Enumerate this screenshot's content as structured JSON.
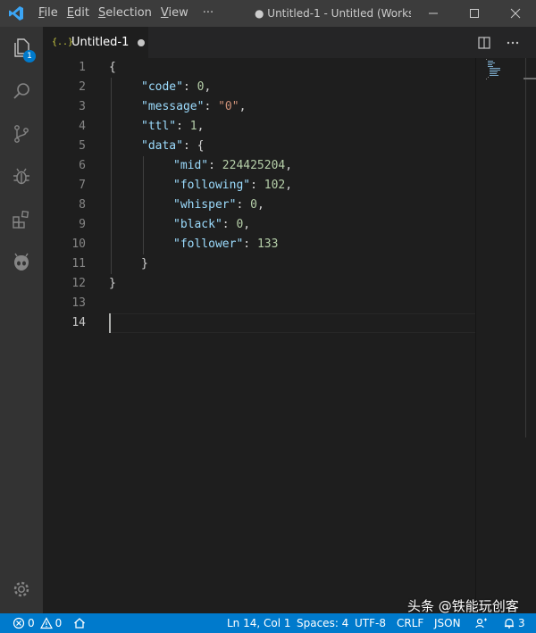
{
  "titlebar": {
    "menus": [
      {
        "mnemonic": "F",
        "rest": "ile"
      },
      {
        "mnemonic": "E",
        "rest": "dit"
      },
      {
        "mnemonic": "S",
        "rest": "election"
      },
      {
        "mnemonic": "V",
        "rest": "iew"
      }
    ],
    "more": "···",
    "title": "● Untitled-1 - Untitled (Worksp..."
  },
  "activitybar": {
    "explorer_badge": "1"
  },
  "tab": {
    "icon_glyph": "{..}",
    "label": "Untitled-1"
  },
  "editor": {
    "line_numbers": [
      "1",
      "2",
      "3",
      "4",
      "5",
      "6",
      "7",
      "8",
      "9",
      "10",
      "11",
      "12",
      "13",
      "14"
    ],
    "json": {
      "code_key": "\"code\"",
      "code_val": "0",
      "message_key": "\"message\"",
      "message_val": "\"0\"",
      "ttl_key": "\"ttl\"",
      "ttl_val": "1",
      "data_key": "\"data\"",
      "mid_key": "\"mid\"",
      "mid_val": "224425204",
      "following_key": "\"following\"",
      "following_val": "102",
      "whisper_key": "\"whisper\"",
      "whisper_val": "0",
      "black_key": "\"black\"",
      "black_val": "0",
      "follower_key": "\"follower\"",
      "follower_val": "133"
    }
  },
  "statusbar": {
    "errors": "0",
    "warnings": "0",
    "position": "Ln 14, Col 1",
    "spaces": "Spaces: 4",
    "encoding": "UTF-8",
    "eol": "CRLF",
    "language": "JSON",
    "notifications": "3"
  },
  "watermark": "头条 @铁能玩创客",
  "colors": {
    "accent": "#007acc",
    "activitybar": "#333333",
    "editor_bg": "#1e1e1e",
    "titlebar": "#3c3c3c"
  }
}
